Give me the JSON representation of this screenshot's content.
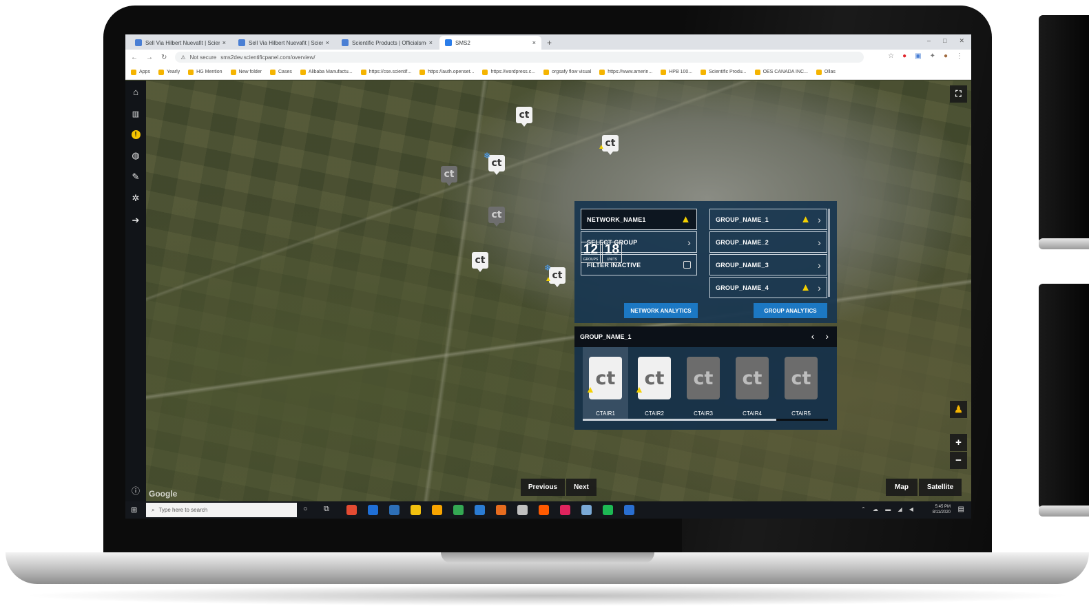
{
  "browser": {
    "tabs": [
      {
        "label": "Sell Via Hilbert Nuevafit | Scientific...",
        "color": "#4a7fd4",
        "active": false
      },
      {
        "label": "Sell Via Hilbert Nuevafit | Scientif...",
        "color": "#4a7fd4",
        "active": false
      },
      {
        "label": "Scientific Products | Officialsmel...",
        "color": "#4a7fd4",
        "active": false
      },
      {
        "label": "SMS2",
        "color": "#2b7de9",
        "active": true
      }
    ],
    "window_controls": [
      "–",
      "□",
      "✕"
    ],
    "url_warning": "Not secure",
    "url": "sms2dev.scientificpanel.com/overview/",
    "bookmarks": [
      "Apps",
      "Yearly",
      "HG Mention",
      "New folder",
      "Cases",
      "Alibaba Manufactu...",
      "https://cse.scientif...",
      "https://auth.openset...",
      "https://wordpress.c...",
      "orgsafy flow visual",
      "https://www.amerin...",
      "HPB 100...",
      "Scientific Produ...",
      "OES CANADA INC...",
      "Ollas"
    ]
  },
  "sidebar": {
    "icons": [
      "home-icon",
      "chart-icon",
      "alert-icon",
      "globe-icon",
      "edit-icon",
      "settings-icon",
      "logout-icon",
      "help-icon"
    ]
  },
  "markers": [
    {
      "label": "ct",
      "state": "active",
      "snow": false,
      "warn": false
    },
    {
      "label": "ct",
      "state": "active",
      "snow": false,
      "warn": true
    },
    {
      "label": "ct",
      "state": "active",
      "snow": true,
      "warn": false
    },
    {
      "label": "ct",
      "state": "inactive",
      "snow": false,
      "warn": false
    },
    {
      "label": "ct",
      "state": "inactive",
      "snow": false,
      "warn": false
    },
    {
      "label": "ct",
      "state": "active",
      "snow": false,
      "warn": false
    },
    {
      "label": "ct",
      "state": "active",
      "snow": true,
      "warn": true
    }
  ],
  "panel": {
    "network_name": "NETWORK_NAME1",
    "select_group": "SELECT GROUP",
    "filter_inactive": "FILTER INACTIVE",
    "groups_count": "12",
    "groups_label": "GROUPS",
    "units_count": "18",
    "units_label": "UNITS",
    "groups": [
      {
        "name": "GROUP_NAME_1",
        "warn": true
      },
      {
        "name": "GROUP_NAME_2",
        "warn": false
      },
      {
        "name": "GROUP_NAME_3",
        "warn": false
      },
      {
        "name": "GROUP_NAME_4",
        "warn": true
      }
    ],
    "network_analytics": "NETWORK ANALYTICS",
    "group_analytics": "GROUP ANALYTICS",
    "selected_group": "GROUP_NAME_1",
    "unit_icon_text": "ct",
    "units": [
      {
        "name": "CTAIR1",
        "state": "active",
        "warn": true
      },
      {
        "name": "CTAIR2",
        "state": "active",
        "warn": true
      },
      {
        "name": "CTAIR3",
        "state": "inactive",
        "warn": false
      },
      {
        "name": "CTAIR4",
        "state": "inactive",
        "warn": false
      },
      {
        "name": "CTAIR5",
        "state": "inactive",
        "warn": false
      }
    ],
    "units_scroll_fraction": 0.79
  },
  "map": {
    "previous": "Previous",
    "next": "Next",
    "map_type": "Map",
    "satellite": "Satellite",
    "google": "Google",
    "zoom_in": "+",
    "zoom_out": "−"
  },
  "taskbar": {
    "search_placeholder": "Type here to search",
    "time": "5:45 PM",
    "date": "8/11/2020",
    "apps": [
      "#e44b32",
      "#1f6fd6",
      "#2d6fb7",
      "#f2c10f",
      "#f7a400",
      "#34a853",
      "#2b7cd3",
      "#e76c1f",
      "#c0c0c0",
      "#ff5a00",
      "#e0245e",
      "#7aa9d6",
      "#1db954",
      "#2a6fd1"
    ]
  }
}
